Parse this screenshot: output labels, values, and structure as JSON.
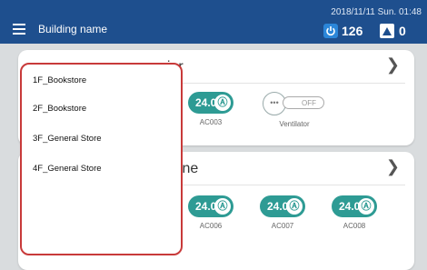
{
  "header": {
    "building_name": "Building name",
    "datetime": "2018/11/11 Sun. 01:48",
    "power_count": "126",
    "alarm_count": "0"
  },
  "groups": [
    {
      "title": "nier",
      "devices": [
        {
          "temp": "24.0",
          "name": "AC003"
        }
      ],
      "ventilator": {
        "name": "Ventilator",
        "state": "OFF"
      }
    },
    {
      "title": "azine",
      "devices": [
        {
          "temp": "24.0",
          "name": "AC006"
        },
        {
          "temp": "24.0",
          "name": "AC007"
        },
        {
          "temp": "24.0",
          "name": "AC008"
        }
      ]
    }
  ],
  "dropdown": {
    "items": [
      "1F_Bookstore",
      "2F_Bookstore",
      "3F_General Store",
      "4F_General Store"
    ]
  },
  "colors": {
    "header_bg": "#1e4f8e",
    "ac_on": "#2e9b94",
    "highlight_border": "#c83a3a"
  }
}
